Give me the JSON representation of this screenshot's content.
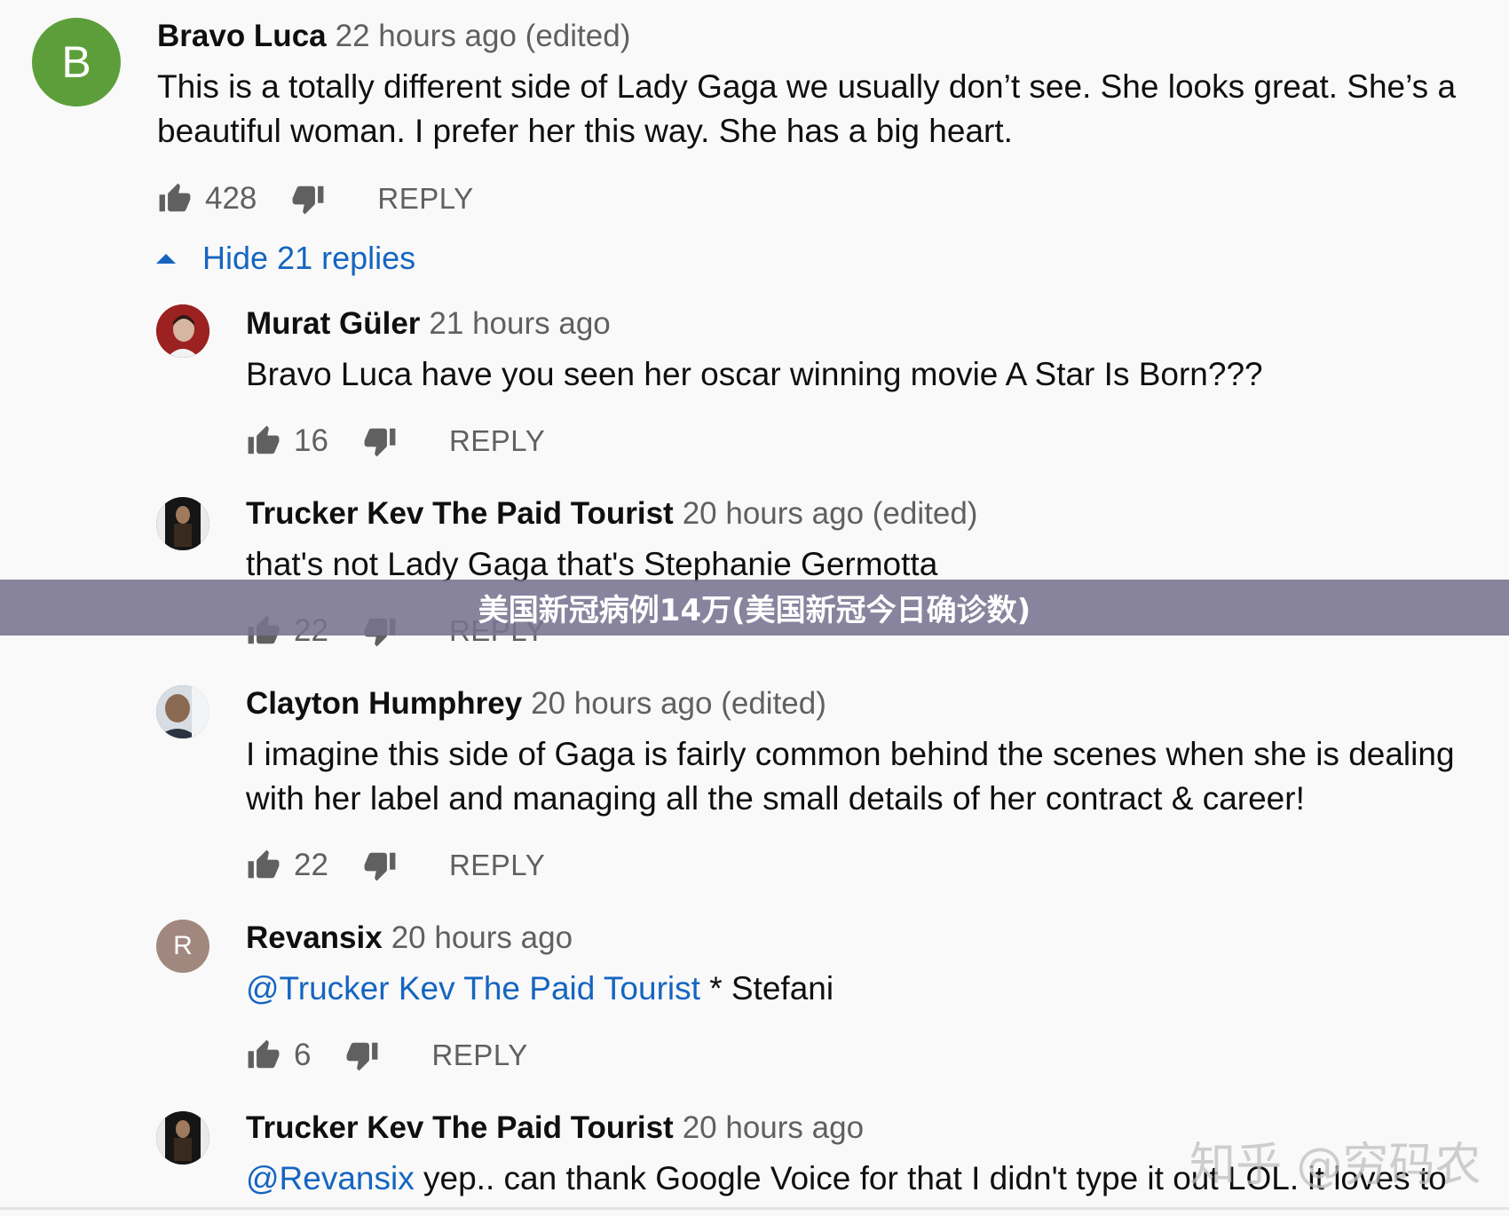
{
  "top_comment": {
    "avatar_letter": "B",
    "avatar_color": "#5c9f3a",
    "author": "Bravo Luca",
    "time": "22 hours ago (edited)",
    "text_line1": "This is a totally different side of Lady Gaga we usually don’t see.  She looks great. She’s a",
    "text_line2": "beautiful woman. I prefer her this way. She has a big heart.",
    "likes": "428",
    "reply_label": "REPLY",
    "toggle_label": "Hide 21 replies"
  },
  "replies": [
    {
      "author": "Murat Güler",
      "time": "21 hours ago",
      "text": "Bravo Luca have you seen her oscar winning movie A Star Is Born???",
      "likes": "16",
      "reply_label": "REPLY"
    },
    {
      "author": "Trucker Kev The Paid Tourist",
      "time": "20 hours ago (edited)",
      "text": "that's not Lady Gaga that's Stephanie Germotta",
      "likes": "22",
      "reply_label": "REPLY"
    },
    {
      "author": "Clayton Humphrey",
      "time": "20 hours ago (edited)",
      "text_line1": "I imagine this side of Gaga is fairly common behind the scenes when she is dealing",
      "text_line2": "with her label and managing all the small details of her contract & career!",
      "likes": "22",
      "reply_label": "REPLY"
    },
    {
      "avatar_letter": "R",
      "avatar_color": "#a1887f",
      "author": "Revansix",
      "time": "20 hours ago",
      "mention": "@Trucker Kev The Paid Tourist",
      "text": " * Stefani",
      "likes": "6",
      "reply_label": "REPLY"
    },
    {
      "author": "Trucker Kev The Paid Tourist",
      "time": "20 hours ago",
      "mention": "@Revansix",
      "text": " yep.. can thank Google Voice for that I didn't type it out LOL. it loves to"
    }
  ],
  "overlay_banner": "美国新冠病例14万(美国新冠今日确诊数)",
  "watermark": "知乎 @穷码农",
  "colors": {
    "link": "#1565c0",
    "secondary_text": "#606060",
    "background": "#f9f9f9"
  }
}
